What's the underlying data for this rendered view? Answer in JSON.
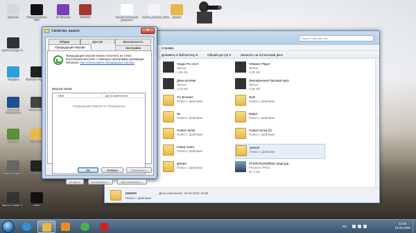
{
  "desktop": {
    "icons": [
      {
        "label": "Корзина",
        "color": "#d9d9d9"
      },
      {
        "label": "Переименовать PDF",
        "color": "#111111"
      },
      {
        "label": "Tor Browser",
        "color": "#7a3fb5"
      },
      {
        "label": "WinRAR",
        "color": "#a23b2f"
      },
      {
        "label": "Новый текстовый документ",
        "color": "#ffffff"
      },
      {
        "label": "Смена_пароля_Mem...",
        "color": "#f4f4f4"
      },
      {
        "label": "фиора",
        "color": "#e8b84a"
      },
      {
        "label": "Крипто Смарт 2...",
        "color": "#333333"
      },
      {
        "label": "Telegram",
        "color": "#2aa1da"
      },
      {
        "label": "Вебмани Пароль",
        "color": "#222222"
      },
      {
        "label": "Штатный Справочник",
        "color": "#1e4f8f"
      },
      {
        "label": "Чтение ЕЦП",
        "color": "#444444"
      },
      {
        "label": "Пробник",
        "color": "#5a8f3c"
      },
      {
        "label": "Фото 2020",
        "color": "#e8b84a"
      },
      {
        "label": "Крипто Смарт 2",
        "color": "#666666"
      },
      {
        "label": "123",
        "color": "#222222"
      },
      {
        "label": "Крипто Смарт 2...",
        "color": "#333333"
      },
      {
        "label": "video",
        "color": "#111111"
      }
    ]
  },
  "explorer": {
    "search_placeholder": "Поиск: Рабочий стол",
    "menu_item": "Справка",
    "toolbar": [
      "Добавить в библиотеку ▾",
      "Общий доступ ▾",
      "Записать на оптический диск"
    ],
    "left_rows": [
      "",
      "",
      "",
      "",
      "",
      "",
      ".openshot_q"
    ],
    "items": [
      {
        "name": "Vegas Pro 10.0",
        "sub": "Ярлык",
        "sub2": "1,86 КБ",
        "kind": "app"
      },
      {
        "name": "VMware Player",
        "sub": "Ярлык",
        "sub2": "2,03 КБ",
        "kind": "app"
      },
      {
        "name": "Демо-ролики",
        "sub": "Ярлык",
        "sub2": "2,29 КБ",
        "kind": "app"
      },
      {
        "name": "Лингафонный базовый курс",
        "sub": "Ярлык",
        "sub2": "2,36 КБ",
        "kind": "app"
      },
      {
        "name": "Tor Browser",
        "sub": "Папка с файлами",
        "sub2": "",
        "kind": "folder"
      },
      {
        "name": "Wub",
        "sub": "Папка с файлами",
        "sub2": "",
        "kind": "folder"
      },
      {
        "name": "аа",
        "sub": "Папка с файлами",
        "sub2": "",
        "kind": "folder"
      },
      {
        "name": "видео",
        "sub": "Папка с файлами",
        "sub2": "",
        "kind": "folder"
      },
      {
        "name": "Новая папка",
        "sub": "Папка с файлами",
        "sub2": "",
        "kind": "folder"
      },
      {
        "name": "Новая папка (2)",
        "sub": "Папка с файлами",
        "sub2": "",
        "kind": "folder"
      },
      {
        "name": "повер поинт",
        "sub": "Папка с файлами",
        "sub2": "",
        "kind": "folder"
      },
      {
        "name": "разное",
        "sub": "Папка с файлами",
        "sub2": "",
        "kind": "folder"
      },
      {
        "name": "фиора",
        "sub": "Папка с файлами",
        "sub2": "",
        "kind": "folder"
      },
      {
        "name": "074257012638834_large.jpg",
        "sub": "Рисунок JPEG",
        "sub2": "97,2 КБ",
        "kind": "image"
      }
    ],
    "status": {
      "name": "разное",
      "date": "Дата изменения: 15.06.2020 16:58",
      "kind": "Папка с файлами"
    }
  },
  "dialog": {
    "title": "Свойства: разное",
    "close_glyph": "✕",
    "tabs": [
      "Общие",
      "Доступ",
      "Безопасность",
      "Предыдущие версии",
      "Настройка"
    ],
    "description": "Предыдущие версии можно получить из точек восстановления или с помощью программы архивации Windows.",
    "link": "Как использовать предыдущие версии",
    "versions_label": "Версии папки:",
    "col_name": "Имя",
    "col_date": "Дата изменения",
    "empty": "Предыдущие версии не обнаружены",
    "buttons": {
      "open": "Открыть",
      "copy": "Копировать...",
      "restore": "Восстановить..."
    },
    "footer": {
      "ok": "ОК",
      "cancel": "Отмена",
      "apply": "Применить"
    }
  },
  "taskbar": {
    "apps": [
      {
        "name": "internet-explorer",
        "color": "#2f8fd8"
      },
      {
        "name": "explorer",
        "color": "#e8b84a"
      },
      {
        "name": "media-player",
        "color": "#f08a1b"
      },
      {
        "name": "chrome",
        "color": "#4caf50"
      },
      {
        "name": "opera",
        "color": "#d3201f"
      }
    ],
    "lang": "RU",
    "time": "13:04",
    "date": "15.06.2020"
  }
}
